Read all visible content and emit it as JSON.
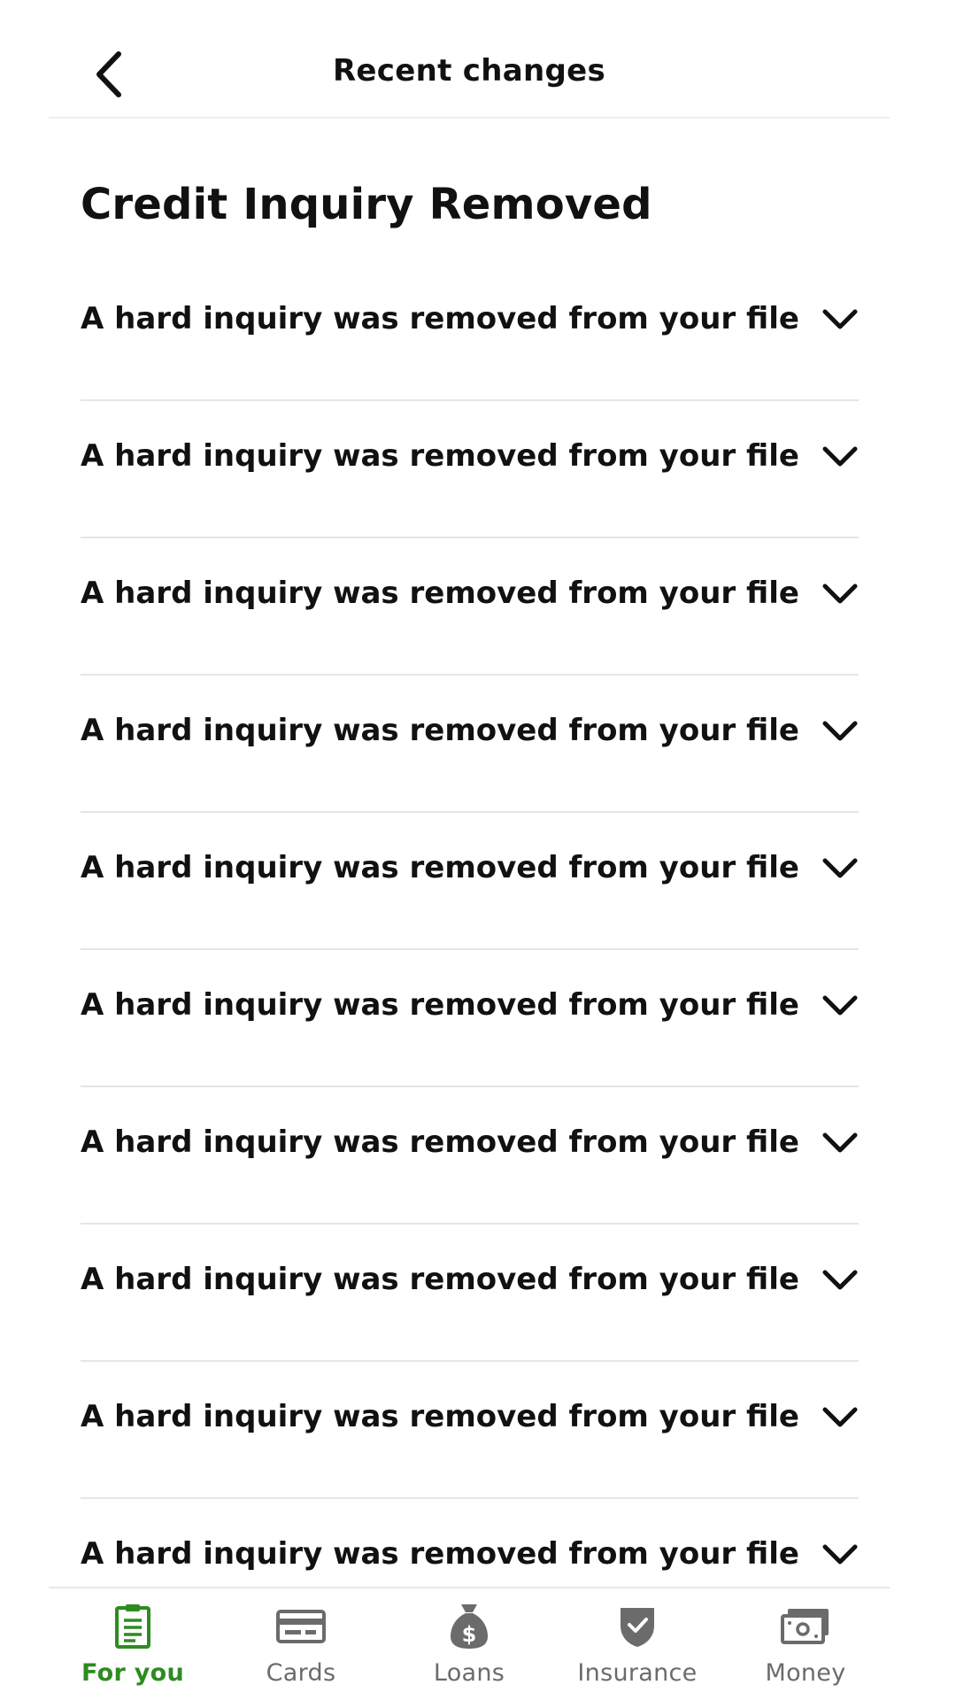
{
  "header": {
    "title": "Recent changes"
  },
  "section": {
    "title": "Credit Inquiry Removed"
  },
  "list": {
    "items": [
      {
        "label": "A hard inquiry was removed from your file"
      },
      {
        "label": "A hard inquiry was removed from your file"
      },
      {
        "label": "A hard inquiry was removed from your file"
      },
      {
        "label": "A hard inquiry was removed from your file"
      },
      {
        "label": "A hard inquiry was removed from your file"
      },
      {
        "label": "A hard inquiry was removed from your file"
      },
      {
        "label": "A hard inquiry was removed from your file"
      },
      {
        "label": "A hard inquiry was removed from your file"
      },
      {
        "label": "A hard inquiry was removed from your file"
      },
      {
        "label": "A hard inquiry was removed from your file"
      }
    ]
  },
  "bottom_nav": {
    "items": [
      {
        "label": "For you",
        "icon": "document-list-icon",
        "active": true
      },
      {
        "label": "Cards",
        "icon": "credit-card-icon",
        "active": false
      },
      {
        "label": "Loans",
        "icon": "money-bag-icon",
        "active": false
      },
      {
        "label": "Insurance",
        "icon": "shield-check-icon",
        "active": false
      },
      {
        "label": "Money",
        "icon": "cash-icon",
        "active": false
      }
    ]
  },
  "colors": {
    "accent": "#2e8b21",
    "text": "#111111",
    "muted": "#6b6b6b",
    "divider": "#e6e6e6"
  }
}
